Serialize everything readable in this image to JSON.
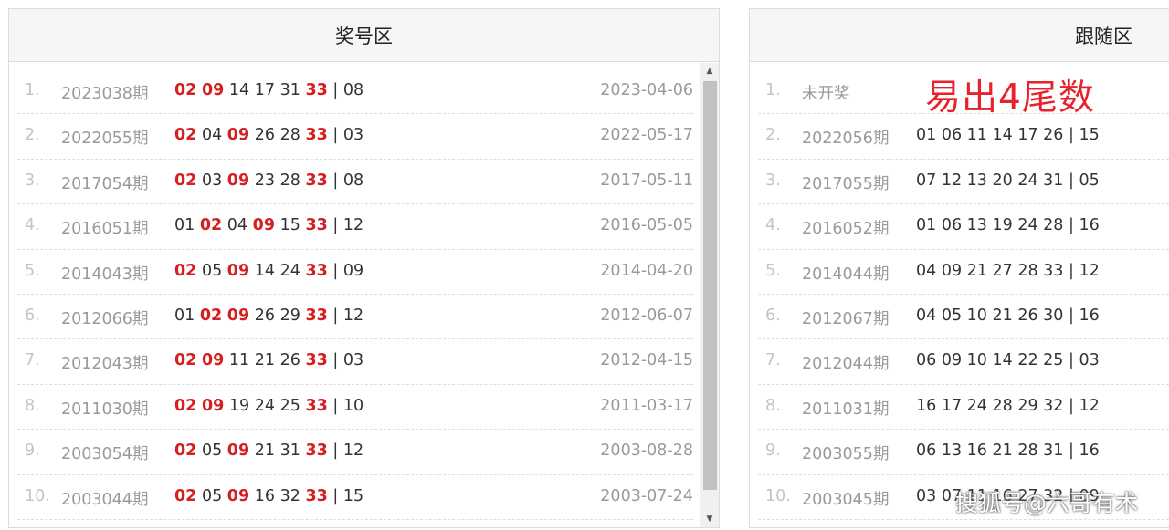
{
  "left_panel": {
    "title": "奖号区",
    "rows": [
      {
        "idx": "1.",
        "period": "2023038期",
        "nums": [
          {
            "v": "02",
            "h": true
          },
          {
            "v": "09",
            "h": true
          },
          {
            "v": "14",
            "h": false
          },
          {
            "v": "17",
            "h": false
          },
          {
            "v": "31",
            "h": false
          },
          {
            "v": "33",
            "h": true
          }
        ],
        "blue": "08",
        "date": "2023-04-06"
      },
      {
        "idx": "2.",
        "period": "2022055期",
        "nums": [
          {
            "v": "02",
            "h": true
          },
          {
            "v": "04",
            "h": false
          },
          {
            "v": "09",
            "h": true
          },
          {
            "v": "26",
            "h": false
          },
          {
            "v": "28",
            "h": false
          },
          {
            "v": "33",
            "h": true
          }
        ],
        "blue": "03",
        "date": "2022-05-17"
      },
      {
        "idx": "3.",
        "period": "2017054期",
        "nums": [
          {
            "v": "02",
            "h": true
          },
          {
            "v": "03",
            "h": false
          },
          {
            "v": "09",
            "h": true
          },
          {
            "v": "23",
            "h": false
          },
          {
            "v": "28",
            "h": false
          },
          {
            "v": "33",
            "h": true
          }
        ],
        "blue": "08",
        "date": "2017-05-11"
      },
      {
        "idx": "4.",
        "period": "2016051期",
        "nums": [
          {
            "v": "01",
            "h": false
          },
          {
            "v": "02",
            "h": true
          },
          {
            "v": "04",
            "h": false
          },
          {
            "v": "09",
            "h": true
          },
          {
            "v": "15",
            "h": false
          },
          {
            "v": "33",
            "h": true
          }
        ],
        "blue": "12",
        "date": "2016-05-05"
      },
      {
        "idx": "5.",
        "period": "2014043期",
        "nums": [
          {
            "v": "02",
            "h": true
          },
          {
            "v": "05",
            "h": false
          },
          {
            "v": "09",
            "h": true
          },
          {
            "v": "14",
            "h": false
          },
          {
            "v": "24",
            "h": false
          },
          {
            "v": "33",
            "h": true
          }
        ],
        "blue": "09",
        "date": "2014-04-20"
      },
      {
        "idx": "6.",
        "period": "2012066期",
        "nums": [
          {
            "v": "01",
            "h": false
          },
          {
            "v": "02",
            "h": true
          },
          {
            "v": "09",
            "h": true
          },
          {
            "v": "26",
            "h": false
          },
          {
            "v": "29",
            "h": false
          },
          {
            "v": "33",
            "h": true
          }
        ],
        "blue": "12",
        "date": "2012-06-07"
      },
      {
        "idx": "7.",
        "period": "2012043期",
        "nums": [
          {
            "v": "02",
            "h": true
          },
          {
            "v": "09",
            "h": true
          },
          {
            "v": "11",
            "h": false
          },
          {
            "v": "21",
            "h": false
          },
          {
            "v": "26",
            "h": false
          },
          {
            "v": "33",
            "h": true
          }
        ],
        "blue": "03",
        "date": "2012-04-15"
      },
      {
        "idx": "8.",
        "period": "2011030期",
        "nums": [
          {
            "v": "02",
            "h": true
          },
          {
            "v": "09",
            "h": true
          },
          {
            "v": "19",
            "h": false
          },
          {
            "v": "24",
            "h": false
          },
          {
            "v": "25",
            "h": false
          },
          {
            "v": "33",
            "h": true
          }
        ],
        "blue": "10",
        "date": "2011-03-17"
      },
      {
        "idx": "9.",
        "period": "2003054期",
        "nums": [
          {
            "v": "02",
            "h": true
          },
          {
            "v": "05",
            "h": false
          },
          {
            "v": "09",
            "h": true
          },
          {
            "v": "21",
            "h": false
          },
          {
            "v": "31",
            "h": false
          },
          {
            "v": "33",
            "h": true
          }
        ],
        "blue": "12",
        "date": "2003-08-28"
      },
      {
        "idx": "10.",
        "period": "2003044期",
        "nums": [
          {
            "v": "02",
            "h": true
          },
          {
            "v": "05",
            "h": false
          },
          {
            "v": "09",
            "h": true
          },
          {
            "v": "16",
            "h": false
          },
          {
            "v": "32",
            "h": false
          },
          {
            "v": "33",
            "h": true
          }
        ],
        "blue": "15",
        "date": "2003-07-24"
      }
    ]
  },
  "right_panel": {
    "title": "跟随区",
    "rows": [
      {
        "idx": "1.",
        "period": "未开奖",
        "numbers": ""
      },
      {
        "idx": "2.",
        "period": "2022056期",
        "numbers": "01 06 11 14 17 26 | 15"
      },
      {
        "idx": "3.",
        "period": "2017055期",
        "numbers": "07 12 13 20 24 31 | 05"
      },
      {
        "idx": "4.",
        "period": "2016052期",
        "numbers": "01 06 13 19 24 28 | 16"
      },
      {
        "idx": "5.",
        "period": "2014044期",
        "numbers": "04 09 21 27 28 33 | 12"
      },
      {
        "idx": "6.",
        "period": "2012067期",
        "numbers": "04 05 10 21 26 30 | 16"
      },
      {
        "idx": "7.",
        "period": "2012044期",
        "numbers": "06 09 10 14 22 25 | 03"
      },
      {
        "idx": "8.",
        "period": "2011031期",
        "numbers": "16 17 24 28 29 32 | 12"
      },
      {
        "idx": "9.",
        "period": "2003055期",
        "numbers": "06 13 16 21 28 31 | 16"
      },
      {
        "idx": "10.",
        "period": "2003045期",
        "numbers": "03 07 11 16 27 32 | 09"
      }
    ]
  },
  "annotation": "易出4尾数",
  "watermark": "搜狐号@六哥有术",
  "colors": {
    "highlight": "#d42020",
    "annotation": "#e8212b"
  },
  "icons": {
    "scroll_up": "triangle-up",
    "scroll_down": "triangle-down"
  }
}
